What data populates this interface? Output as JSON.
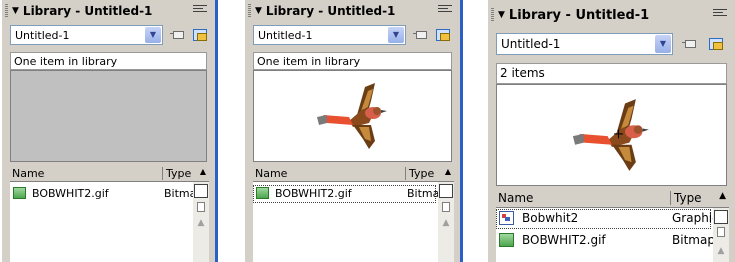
{
  "panels": [
    {
      "title": "Library - Untitled-1",
      "document": "Untitled-1",
      "status": "One item in library",
      "preview": "empty",
      "columns": {
        "name": "Name",
        "type": "Type"
      },
      "rows": [
        {
          "name": "BOBWHIT2.gif",
          "type": "Bitmap",
          "icon": "bitmap-icon"
        }
      ]
    },
    {
      "title": "Library - Untitled-1",
      "document": "Untitled-1",
      "status": "One item in library",
      "preview": "bird",
      "columns": {
        "name": "Name",
        "type": "Type"
      },
      "rows": [
        {
          "name": "BOBWHIT2.gif",
          "type": "Bitmap",
          "icon": "bitmap-icon"
        }
      ]
    },
    {
      "title": "Library - Untitled-1",
      "document": "Untitled-1",
      "status": "2 items",
      "preview": "bird",
      "columns": {
        "name": "Name",
        "type": "Type"
      },
      "rows": [
        {
          "name": "Bobwhit2",
          "type": "Graphic",
          "icon": "graphic-symbol-icon"
        },
        {
          "name": "BOBWHIT2.gif",
          "type": "Bitmap",
          "icon": "bitmap-icon"
        }
      ]
    }
  ],
  "icons": {
    "collapse": "triangle-down-icon",
    "options_menu": "options-menu-icon",
    "dropdown": "chevron-down-icon",
    "pin": "pin-library-icon",
    "new_library_panel": "new-library-panel-icon",
    "sort": "sort-toggle-icon"
  },
  "colors": {
    "panel_bg": "#d4d0c8",
    "preview_empty": "#c0c0c0",
    "accent_edge": "#2a5fc7"
  }
}
